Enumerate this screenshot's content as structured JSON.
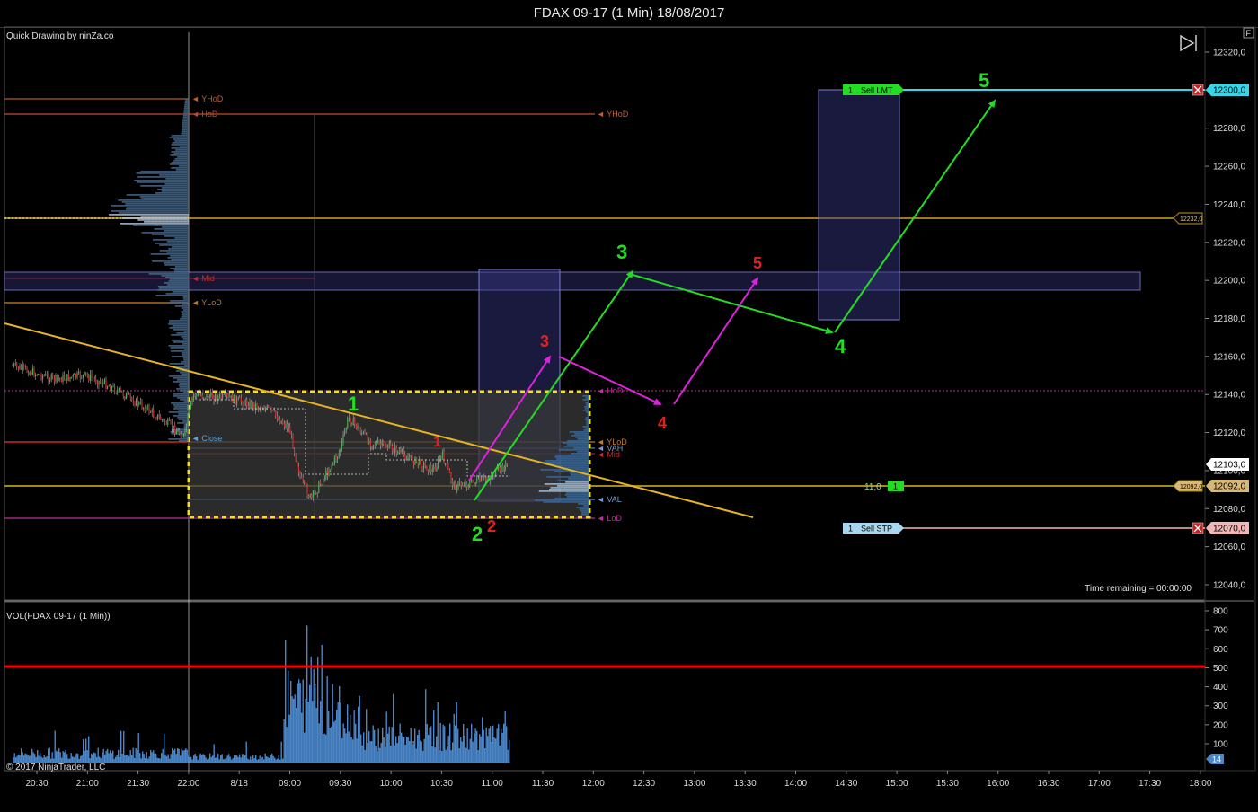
{
  "window": {
    "title": "FDAX 09-17 (1 Min)  18/08/2017"
  },
  "price_panel": {
    "indicator_label": "Quick Drawing by ninZa.co",
    "time_remaining": "Time remaining = 00:00:00",
    "f_button": "F"
  },
  "volume_panel": {
    "label": "VOL(FDAX 09-17 (1 Min))",
    "copyright": "© 2017 NinjaTrader, LLC",
    "current_volume": "14"
  },
  "orders": {
    "sell_lmt": {
      "qty": "1",
      "label": "Sell LMT",
      "price": "12300,0"
    },
    "sell_stp": {
      "qty": "1",
      "label": "Sell STP",
      "price": "12070,0"
    },
    "position": {
      "pnl": "11,0",
      "qty": "1",
      "price": "12092,0"
    },
    "last_price": "12103,0",
    "level_tag": "12232,0"
  },
  "levels": {
    "yhod_left": "YHoD",
    "yhod_right": "YHoD",
    "hod": "HoD",
    "mid": "Mid",
    "ylod": "YLoD",
    "close": "Close",
    "hod2": "HoD",
    "ylod2": "YLoD",
    "vah": "VAH",
    "mid2": "Mid",
    "val": "VAL",
    "lod": "LoD"
  },
  "colors": {
    "background": "#000000",
    "up_candle": "#4caf50",
    "down_candle": "#d32f2f",
    "green_arrow": "#22dd22",
    "magenta_arrow": "#dd22dd",
    "trendline": "#e6b422",
    "volume_bar": "#4a86c8",
    "volume_level": "#ff0000",
    "sell_lmt_line": "#36d6e7",
    "sell_stp_line": "#f2b8b8"
  },
  "annotations": {
    "green_labels": [
      "1",
      "2",
      "3",
      "4",
      "5"
    ],
    "red_labels": [
      "1",
      "2",
      "3",
      "4",
      "5"
    ]
  },
  "chart_data": [
    {
      "type": "candlestick",
      "title": "FDAX 09-17 (1 Min)  18/08/2017",
      "y_ticks": [
        "12320,0",
        "12300,0",
        "12280,0",
        "12260,0",
        "12240,0",
        "12220,0",
        "12200,0",
        "12180,0",
        "12160,0",
        "12140,0",
        "12120,0",
        "12100,0",
        "12080,0",
        "12060,0",
        "12040,0"
      ],
      "x_ticks": [
        "20:30",
        "21:00",
        "21:30",
        "22:00",
        "8/18",
        "09:00",
        "09:30",
        "10:00",
        "10:30",
        "11:00",
        "11:30",
        "12:00",
        "12:30",
        "13:00",
        "13:30",
        "14:00",
        "14:30",
        "15:00",
        "15:30",
        "16:00",
        "16:30",
        "17:00",
        "17:30",
        "18:00"
      ],
      "ylim": [
        12030,
        12330
      ],
      "price_path": [
        [
          "20:30",
          12155
        ],
        [
          "20:50",
          12148
        ],
        [
          "21:10",
          12150
        ],
        [
          "21:30",
          12145
        ],
        [
          "21:45",
          12132
        ],
        [
          "22:00",
          12118
        ],
        [
          "22:05",
          12140
        ],
        [
          "22:30",
          12138
        ],
        [
          "22:45",
          12132
        ],
        [
          "09:00",
          12122
        ],
        [
          "09:10",
          12095
        ],
        [
          "09:20",
          12085
        ],
        [
          "09:30",
          12110
        ],
        [
          "09:35",
          12128
        ],
        [
          "09:45",
          12115
        ],
        [
          "10:00",
          12112
        ],
        [
          "10:15",
          12105
        ],
        [
          "10:30",
          12100
        ],
        [
          "10:40",
          12108
        ],
        [
          "10:50",
          12092
        ],
        [
          "11:00",
          12095
        ],
        [
          "11:10",
          12100
        ],
        [
          "11:15",
          12103
        ]
      ],
      "horizontal_levels": [
        12300,
        12232,
        12200,
        12092,
        12070
      ]
    },
    {
      "type": "bar",
      "title": "VOL(FDAX 09-17 (1 Min))",
      "y_ticks": [
        "800",
        "700",
        "600",
        "500",
        "400",
        "300",
        "200",
        "100"
      ],
      "ylim": [
        0,
        820
      ],
      "reference_level": 500,
      "last_value": 14
    }
  ]
}
